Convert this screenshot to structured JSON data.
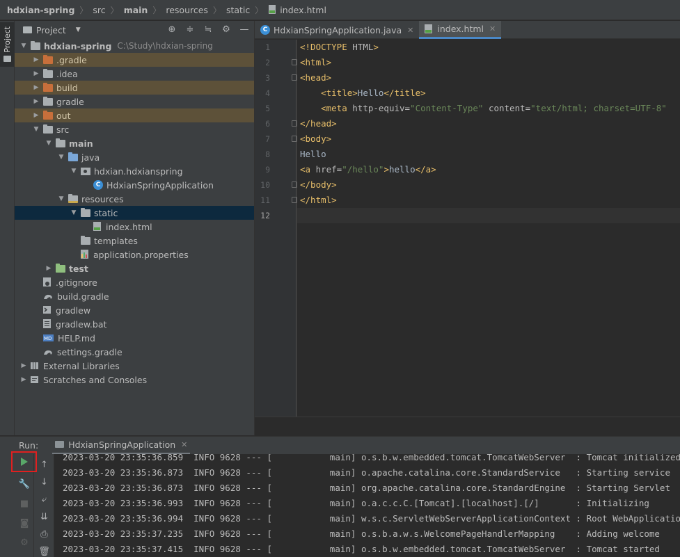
{
  "breadcrumb": [
    {
      "label": "hdxian-spring",
      "bold": true
    },
    {
      "label": "src",
      "bold": false
    },
    {
      "label": "main",
      "bold": true
    },
    {
      "label": "resources",
      "bold": false
    },
    {
      "label": "static",
      "bold": false
    },
    {
      "label": "index.html",
      "bold": false,
      "icon": "html-file-icon"
    }
  ],
  "left_strip": {
    "project_tab": "Project"
  },
  "project_panel": {
    "title": "Project",
    "tools": [
      "locate-icon",
      "expand-all-icon",
      "collapse-all-icon",
      "gear-icon",
      "minimize-icon"
    ],
    "tree": [
      {
        "label": "hdxian-spring",
        "path": "C:\\Study\\hdxian-spring",
        "depth": 0,
        "expanded": true,
        "icon": "project-folder",
        "bold": true
      },
      {
        "label": ".gradle",
        "depth": 1,
        "expanded": false,
        "icon": "excluded-folder",
        "excluded": true
      },
      {
        "label": ".idea",
        "depth": 1,
        "expanded": false,
        "icon": "folder"
      },
      {
        "label": "build",
        "depth": 1,
        "expanded": false,
        "icon": "excluded-folder",
        "excluded": true
      },
      {
        "label": "gradle",
        "depth": 1,
        "expanded": false,
        "icon": "folder"
      },
      {
        "label": "out",
        "depth": 1,
        "expanded": false,
        "icon": "excluded-folder",
        "excluded": true
      },
      {
        "label": "src",
        "depth": 1,
        "expanded": true,
        "icon": "folder"
      },
      {
        "label": "main",
        "depth": 2,
        "expanded": true,
        "icon": "folder",
        "bold": true
      },
      {
        "label": "java",
        "depth": 3,
        "expanded": true,
        "icon": "source-folder"
      },
      {
        "label": "hdxian.hdxianspring",
        "depth": 4,
        "expanded": true,
        "icon": "package"
      },
      {
        "label": "HdxianSpringApplication",
        "depth": 5,
        "leaf": true,
        "icon": "class"
      },
      {
        "label": "resources",
        "depth": 3,
        "expanded": true,
        "icon": "resources-folder"
      },
      {
        "label": "static",
        "depth": 4,
        "expanded": true,
        "icon": "folder",
        "selected": true
      },
      {
        "label": "index.html",
        "depth": 5,
        "leaf": true,
        "icon": "html-file"
      },
      {
        "label": "templates",
        "depth": 4,
        "leaf": true,
        "icon": "folder"
      },
      {
        "label": "application.properties",
        "depth": 4,
        "leaf": true,
        "icon": "properties-file"
      },
      {
        "label": "test",
        "depth": 2,
        "expanded": false,
        "icon": "test-folder",
        "bold": true
      },
      {
        "label": ".gitignore",
        "depth": 1,
        "leaf": true,
        "icon": "gitignore-file"
      },
      {
        "label": "build.gradle",
        "depth": 1,
        "leaf": true,
        "icon": "gradle-file"
      },
      {
        "label": "gradlew",
        "depth": 1,
        "leaf": true,
        "icon": "script-file"
      },
      {
        "label": "gradlew.bat",
        "depth": 1,
        "leaf": true,
        "icon": "text-file"
      },
      {
        "label": "HELP.md",
        "depth": 1,
        "leaf": true,
        "icon": "markdown-file"
      },
      {
        "label": "settings.gradle",
        "depth": 1,
        "leaf": true,
        "icon": "gradle-file"
      },
      {
        "label": "External Libraries",
        "depth": 0,
        "expanded": false,
        "icon": "libraries"
      },
      {
        "label": "Scratches and Consoles",
        "depth": 0,
        "expanded": false,
        "icon": "scratches"
      }
    ]
  },
  "editor": {
    "tabs": [
      {
        "label": "HdxianSpringApplication.java",
        "active": false,
        "icon": "class-icon"
      },
      {
        "label": "index.html",
        "active": true,
        "icon": "html-file-icon"
      }
    ],
    "current_line": 12,
    "lines": [
      [
        {
          "t": "tag",
          "v": "<!DOCTYPE "
        },
        {
          "t": "attr",
          "v": "HTML"
        },
        {
          "t": "tag",
          "v": ">"
        }
      ],
      [
        {
          "t": "tag",
          "v": "<html>"
        }
      ],
      [
        {
          "t": "tag",
          "v": "<head>"
        }
      ],
      [
        {
          "t": "txt",
          "v": "    "
        },
        {
          "t": "tag",
          "v": "<title>"
        },
        {
          "t": "txt",
          "v": "Hello"
        },
        {
          "t": "tag",
          "v": "</title>"
        }
      ],
      [
        {
          "t": "txt",
          "v": "    "
        },
        {
          "t": "tag",
          "v": "<meta "
        },
        {
          "t": "attr",
          "v": "http-equiv="
        },
        {
          "t": "val",
          "v": "\"Content-Type\""
        },
        {
          "t": "attr",
          "v": " content="
        },
        {
          "t": "val",
          "v": "\"text/html; charset=UTF-8\""
        }
      ],
      [
        {
          "t": "tag",
          "v": "</head>"
        }
      ],
      [
        {
          "t": "tag",
          "v": "<body>"
        }
      ],
      [
        {
          "t": "txt",
          "v": "Hello"
        }
      ],
      [
        {
          "t": "tag",
          "v": "<a "
        },
        {
          "t": "attr",
          "v": "href="
        },
        {
          "t": "val",
          "v": "\"/hello\""
        },
        {
          "t": "tag",
          "v": ">"
        },
        {
          "t": "txt",
          "v": "hello"
        },
        {
          "t": "tag",
          "v": "</a>"
        }
      ],
      [
        {
          "t": "tag",
          "v": "</body>"
        }
      ],
      [
        {
          "t": "tag",
          "v": "</html>"
        }
      ],
      []
    ],
    "fold_lines": [
      2,
      3,
      6,
      7,
      10,
      11
    ]
  },
  "run": {
    "label": "Run:",
    "tab": "HdxianSpringApplication",
    "tools_col1": [
      "rerun-icon",
      "wrench-icon",
      "stop-icon",
      "camera-icon",
      "gear-icon",
      "exit-icon"
    ],
    "tools_col2": [
      "up-arrow-icon",
      "down-arrow-icon",
      "soft-wrap-icon",
      "scroll-to-end-icon",
      "print-icon",
      "trash-icon"
    ],
    "log": [
      "2023-03-20 23:35:36.859  INFO 9628 --- [           main] o.s.b.w.embedded.tomcat.TomcatWebServer  : Tomcat initialized",
      "2023-03-20 23:35:36.873  INFO 9628 --- [           main] o.apache.catalina.core.StandardService   : Starting service",
      "2023-03-20 23:35:36.873  INFO 9628 --- [           main] org.apache.catalina.core.StandardEngine  : Starting Servlet",
      "2023-03-20 23:35:36.993  INFO 9628 --- [           main] o.a.c.c.C.[Tomcat].[localhost].[/]       : Initializing",
      "2023-03-20 23:35:36.994  INFO 9628 --- [           main] w.s.c.ServletWebServerApplicationContext : Root WebApplication",
      "2023-03-20 23:35:37.235  INFO 9628 --- [           main] o.s.b.a.w.s.WelcomePageHandlerMapping    : Adding welcome",
      "2023-03-20 23:35:37.415  INFO 9628 --- [           main] o.s.b.w.embedded.tomcat.TomcatWebServer  : Tomcat started"
    ]
  },
  "colors": {
    "accent": "#4a88c7",
    "run_highlight": "#e02020",
    "play": "#59a869"
  }
}
